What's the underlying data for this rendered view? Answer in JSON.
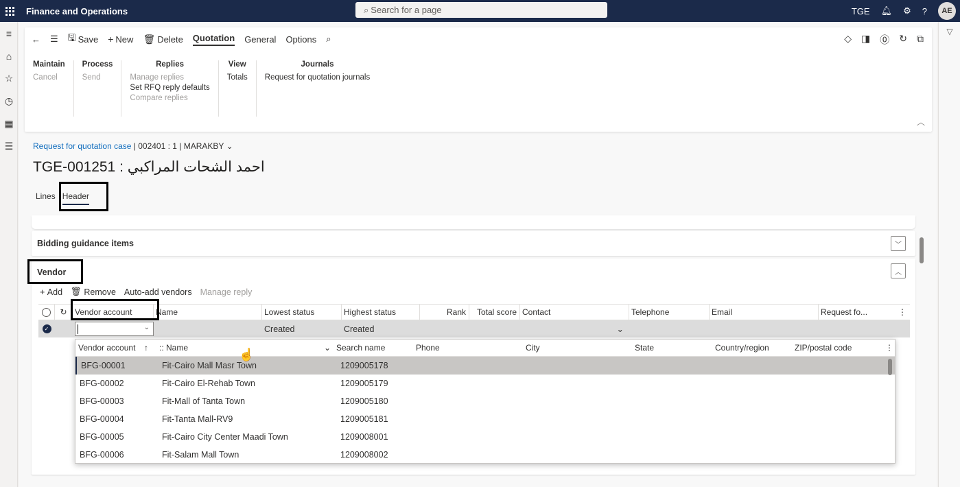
{
  "app": {
    "title": "Finance and Operations",
    "search_placeholder": "Search for a page",
    "company": "TGE",
    "user_initials": "AE"
  },
  "toolbar": {
    "save": "Save",
    "new": "New",
    "delete": "Delete",
    "tabs": [
      "Quotation",
      "General",
      "Options"
    ]
  },
  "action_groups": {
    "maintain": {
      "title": "Maintain",
      "items": [
        "Cancel"
      ]
    },
    "process": {
      "title": "Process",
      "items": [
        "Send"
      ]
    },
    "replies": {
      "title": "Replies",
      "items": [
        "Manage replies",
        "Set RFQ reply defaults",
        "Compare replies"
      ]
    },
    "view": {
      "title": "View",
      "items": [
        "Totals"
      ]
    },
    "journals": {
      "title": "Journals",
      "items": [
        "Request for quotation journals"
      ]
    }
  },
  "breadcrumb": {
    "link": "Request for quotation case",
    "id": "002401 : 1",
    "user": "MARAKBY"
  },
  "page_title": "TGE-001251 : احمد الشحات المراكبي",
  "pivots": {
    "lines": "Lines",
    "header": "Header"
  },
  "fasttabs": {
    "bidding": "Bidding guidance items",
    "vendor": "Vendor"
  },
  "vendor_toolbar": {
    "add": "Add",
    "remove": "Remove",
    "auto_add": "Auto-add vendors",
    "manage_reply": "Manage reply"
  },
  "vendor_grid": {
    "columns": [
      "Vendor account",
      "Name",
      "Lowest status",
      "Highest status",
      "Rank",
      "Total score",
      "Contact",
      "Telephone",
      "Email",
      "Request fo..."
    ],
    "row": {
      "lowest_status": "Created",
      "highest_status": "Created"
    }
  },
  "lookup": {
    "columns": [
      "Vendor account",
      "Name",
      "Search name",
      "Phone",
      "City",
      "State",
      "Country/region",
      "ZIP/postal code"
    ],
    "rows": [
      {
        "account": "BFG-00001",
        "name": "Fit-Cairo Mall Masr Town",
        "search": "1209005178"
      },
      {
        "account": "BFG-00002",
        "name": "Fit-Cairo El-Rehab Town",
        "search": "1209005179"
      },
      {
        "account": "BFG-00003",
        "name": "Fit-Mall of Tanta Town",
        "search": "1209005180"
      },
      {
        "account": "BFG-00004",
        "name": "Fit-Tanta Mall-RV9",
        "search": "1209005181"
      },
      {
        "account": "BFG-00005",
        "name": "Fit-Cairo City Center Maadi Town",
        "search": "1209008001"
      },
      {
        "account": "BFG-00006",
        "name": "Fit-Salam Mall Town",
        "search": "1209008002"
      }
    ]
  }
}
